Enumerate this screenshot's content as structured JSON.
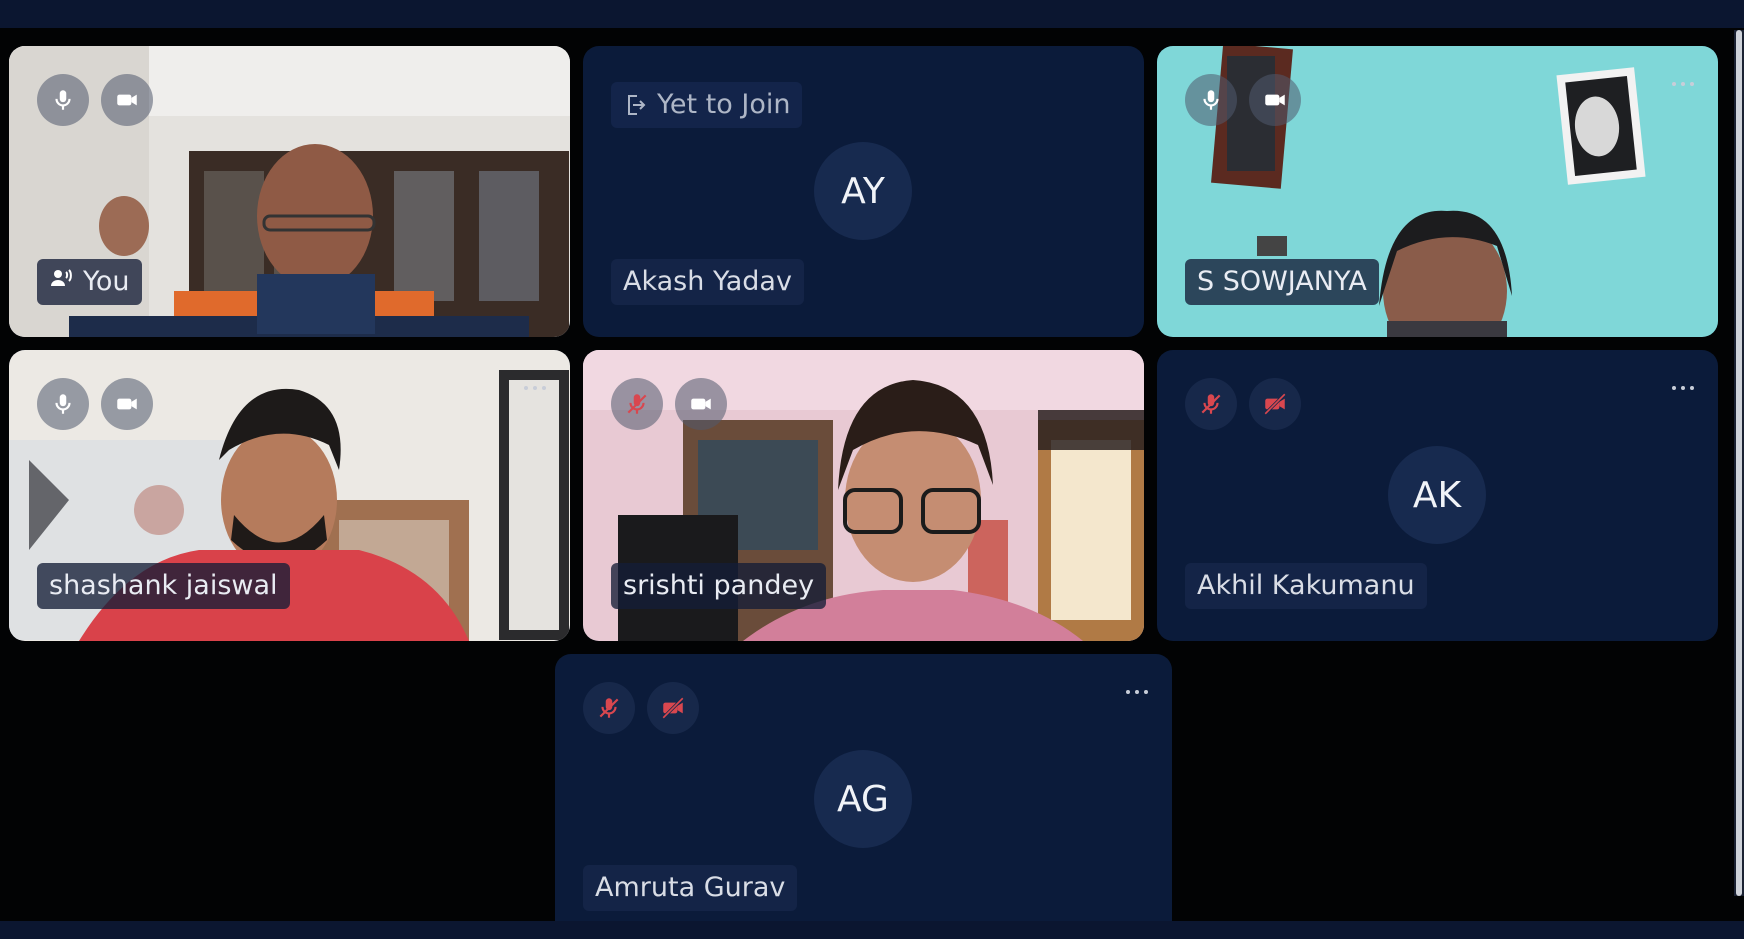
{
  "app": {
    "colors": {
      "tile_bg": "#0b1b3a",
      "muted_red": "#d9474f",
      "page_bg": "#020304"
    }
  },
  "participants": [
    {
      "name": "You",
      "type": "video",
      "mic": "on",
      "camera": "on",
      "speaking": true
    },
    {
      "name": "Akash Yadav",
      "type": "avatar",
      "initials": "AY",
      "status": "Yet to Join"
    },
    {
      "name": "S SOWJANYA",
      "type": "video",
      "mic": "on",
      "camera": "on"
    },
    {
      "name": "shashank jaiswal",
      "type": "video",
      "mic": "on",
      "camera": "on"
    },
    {
      "name": "srishti pandey",
      "type": "video",
      "mic": "off",
      "camera": "on"
    },
    {
      "name": "Akhil Kakumanu",
      "type": "avatar",
      "initials": "AK",
      "mic": "off",
      "camera": "off"
    },
    {
      "name": "Amruta Gurav",
      "type": "avatar",
      "initials": "AG",
      "mic": "off",
      "camera": "off"
    }
  ],
  "icons": {
    "mic": "microphone-icon",
    "mic_off": "microphone-off-icon",
    "cam": "video-camera-icon",
    "cam_off": "video-camera-off-icon",
    "more": "more-horizontal-icon",
    "speaker": "speaking-user-icon",
    "join": "join-exit-icon"
  }
}
